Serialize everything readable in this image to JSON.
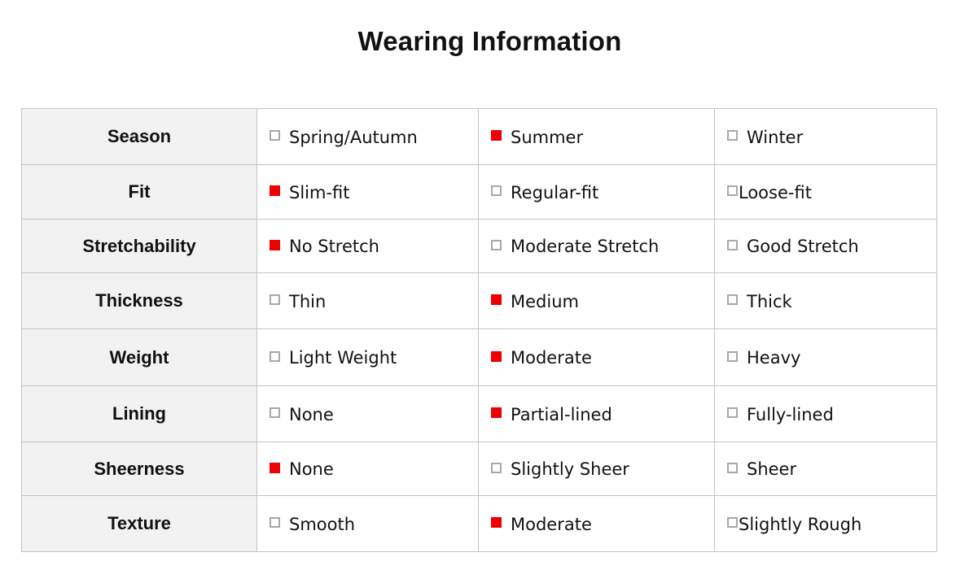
{
  "title": "Wearing Information",
  "colors": {
    "checked": "#ee0000",
    "unchecked_border": "#a8a8a8",
    "label_bg": "#f2f2f2",
    "grid": "#c4c4c4"
  },
  "rows": [
    {
      "label": "Season",
      "options": [
        {
          "text": "Spring/Autumn",
          "checked": false
        },
        {
          "text": "Summer",
          "checked": true
        },
        {
          "text": "Winter",
          "checked": false
        }
      ]
    },
    {
      "label": "Fit",
      "options": [
        {
          "text": "Slim-fit",
          "checked": true
        },
        {
          "text": "Regular-fit",
          "checked": false
        },
        {
          "text": "Loose-fit",
          "checked": false
        }
      ]
    },
    {
      "label": "Stretchability",
      "options": [
        {
          "text": "No Stretch",
          "checked": true
        },
        {
          "text": "Moderate Stretch",
          "checked": false
        },
        {
          "text": "Good Stretch",
          "checked": false
        }
      ]
    },
    {
      "label": "Thickness",
      "options": [
        {
          "text": "Thin",
          "checked": false
        },
        {
          "text": "Medium",
          "checked": true
        },
        {
          "text": "Thick",
          "checked": false
        }
      ]
    },
    {
      "label": "Weight",
      "options": [
        {
          "text": "Light Weight",
          "checked": false
        },
        {
          "text": "Moderate",
          "checked": true
        },
        {
          "text": "Heavy",
          "checked": false
        }
      ]
    },
    {
      "label": "Lining",
      "options": [
        {
          "text": "None",
          "checked": false
        },
        {
          "text": "Partial-lined",
          "checked": true
        },
        {
          "text": "Fully-lined",
          "checked": false
        }
      ]
    },
    {
      "label": "Sheerness",
      "options": [
        {
          "text": "None",
          "checked": true
        },
        {
          "text": "Slightly Sheer",
          "checked": false
        },
        {
          "text": "Sheer",
          "checked": false
        }
      ]
    },
    {
      "label": "Texture",
      "options": [
        {
          "text": "Smooth",
          "checked": false
        },
        {
          "text": "Moderate",
          "checked": true
        },
        {
          "text": "Slightly Rough",
          "checked": false
        }
      ]
    }
  ]
}
